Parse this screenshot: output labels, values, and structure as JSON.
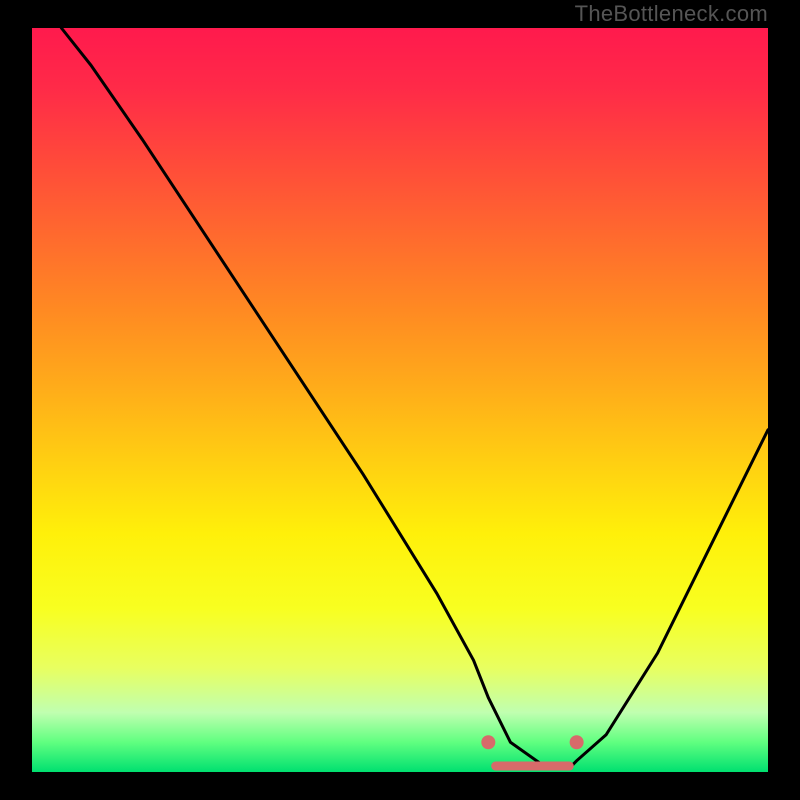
{
  "watermark": "TheBottleneck.com",
  "chart_data": {
    "type": "line",
    "title": "",
    "xlabel": "",
    "ylabel": "",
    "xlim": [
      0,
      100
    ],
    "ylim": [
      0,
      100
    ],
    "series": [
      {
        "name": "bottleneck-curve",
        "x": [
          4,
          8,
          15,
          25,
          35,
          45,
          55,
          60,
          62,
          65,
          70,
          73,
          74,
          78,
          85,
          92,
          100
        ],
        "values": [
          100,
          95,
          85,
          70,
          55,
          40,
          24,
          15,
          10,
          4,
          0.5,
          0.5,
          1.5,
          5,
          16,
          30,
          46
        ]
      }
    ],
    "markers": [
      {
        "x": 62,
        "y": 4,
        "name": "recommended-start"
      },
      {
        "x": 74,
        "y": 4,
        "name": "recommended-end"
      }
    ],
    "recommended_range": {
      "x_start": 63,
      "x_end": 73,
      "y": 0.8
    }
  },
  "colors": {
    "curve": "#000000",
    "marker": "#d76a6a",
    "range_bar": "#d76a6a"
  }
}
